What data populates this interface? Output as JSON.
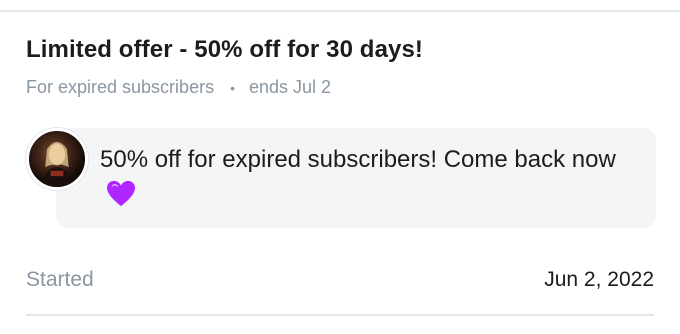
{
  "offer": {
    "title": "Limited offer - 50% off for 30 days!",
    "audience": "For expired subscribers",
    "separator": "•",
    "ends": "ends Jul 2"
  },
  "message": {
    "text": "50% off for expired subscribers! Come back now",
    "emoji_icon": "purple-heart-icon"
  },
  "details": {
    "started_label": "Started",
    "started_value": "Jun 2, 2022"
  },
  "colors": {
    "muted_text": "#8a96a3",
    "bubble_bg": "#f4f5f7",
    "heart": "#b026ff"
  }
}
